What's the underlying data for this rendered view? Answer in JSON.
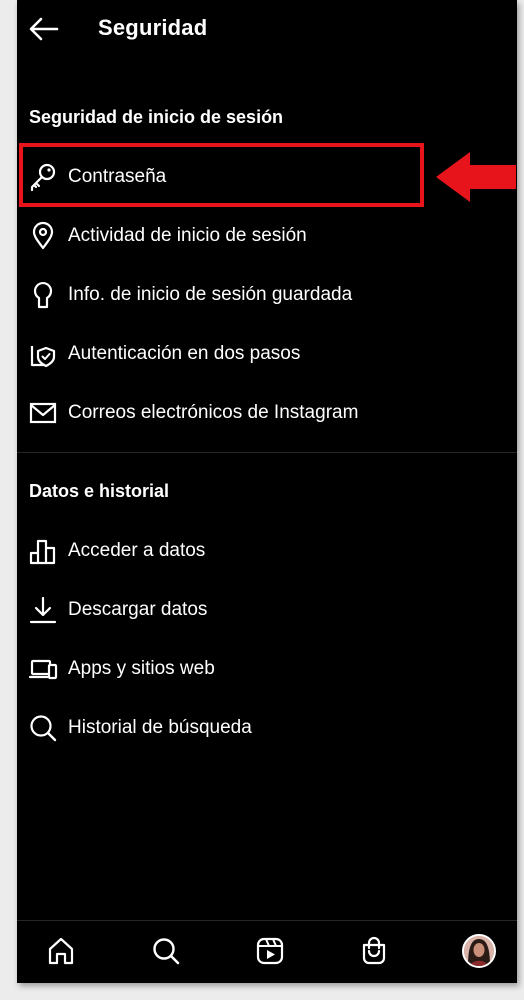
{
  "header": {
    "title": "Seguridad",
    "back_icon": "arrow-left-icon"
  },
  "sections": [
    {
      "title": "Seguridad de inicio de sesión",
      "items": [
        {
          "label": "Contraseña",
          "icon": "key-icon"
        },
        {
          "label": "Actividad de inicio de sesión",
          "icon": "location-pin-icon"
        },
        {
          "label": "Info. de inicio de sesión guardada",
          "icon": "keyhole-icon"
        },
        {
          "label": "Autenticación en dos pasos",
          "icon": "shield-check-icon"
        },
        {
          "label": "Correos electrónicos de Instagram",
          "icon": "envelope-icon"
        }
      ]
    },
    {
      "title": "Datos e historial",
      "items": [
        {
          "label": "Acceder a datos",
          "icon": "bar-chart-icon"
        },
        {
          "label": "Descargar datos",
          "icon": "download-icon"
        },
        {
          "label": "Apps y sitios web",
          "icon": "devices-icon"
        },
        {
          "label": "Historial de búsqueda",
          "icon": "search-icon"
        }
      ]
    }
  ],
  "bottom_nav": [
    {
      "icon": "home-icon"
    },
    {
      "icon": "search-icon"
    },
    {
      "icon": "reels-icon"
    },
    {
      "icon": "shop-icon"
    },
    {
      "icon": "profile-avatar"
    }
  ],
  "colors": {
    "background": "#000000",
    "text": "#ffffff",
    "divider": "#262626",
    "annotation_red": "#e8141c"
  }
}
